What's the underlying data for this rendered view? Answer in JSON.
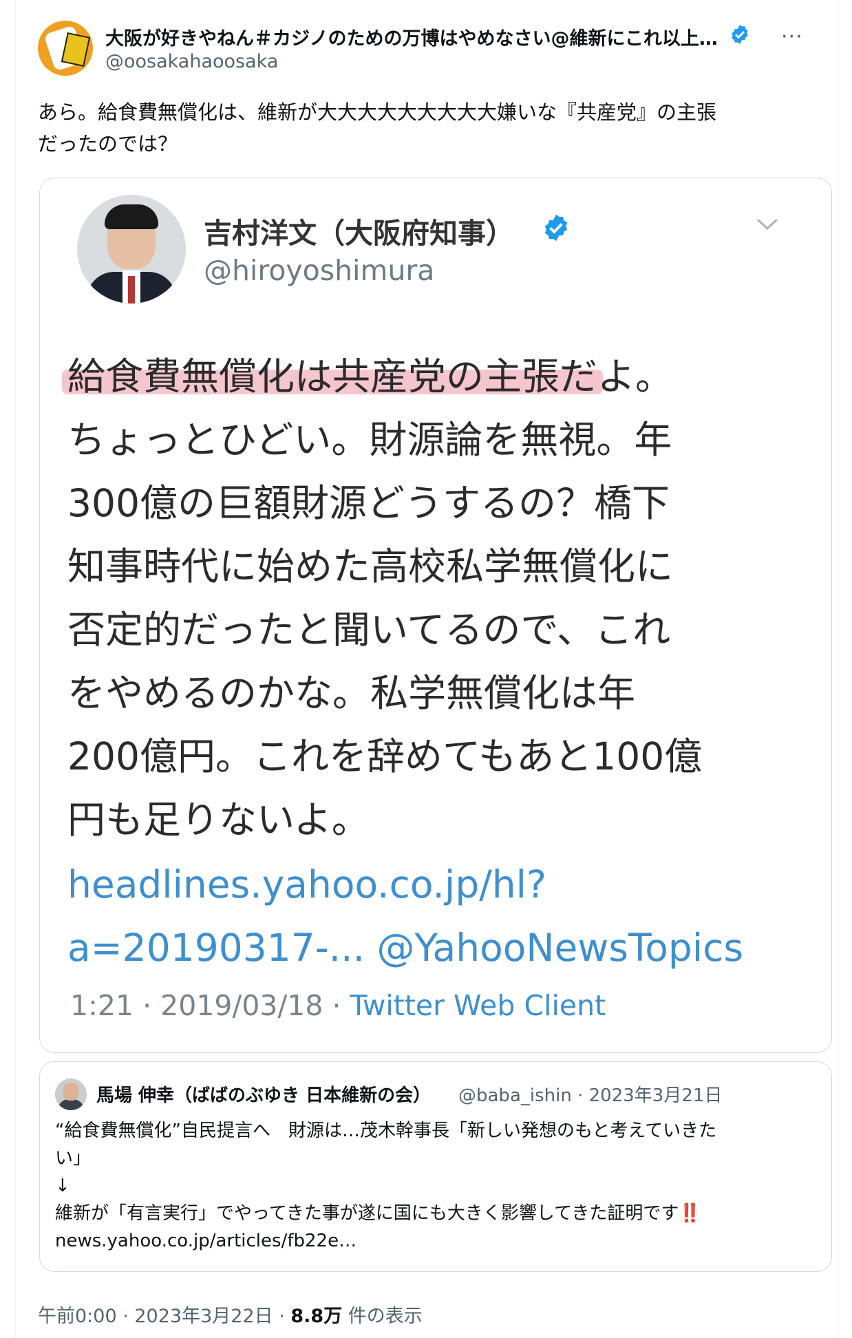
{
  "author": {
    "display_name": "大阪が好きやねん＃カジノのための万博はやめなさい@維新にこれ以上…",
    "handle": "@oosakahaoosaka"
  },
  "more_glyph": "···",
  "tweet": {
    "text_line1": "あら。給食費無償化は、維新が大大大大大大大大大嫌いな『共産党』の主張",
    "text_line2": "だったのでは？"
  },
  "embedded": {
    "name": "吉村洋文（大阪府知事）",
    "handle": "@hiroyoshimura",
    "highlight_line": "給食費無償化は共産党の主張だよ。",
    "body_lines": [
      "ちょっとひどい。財源論を無視。年",
      "300億の巨額財源どうするの？橋下",
      "知事時代に始めた高校私学無償化に",
      "否定的だったと聞いてるので、これ",
      "をやめるのかな。私学無償化は年",
      "200億円。これを辞めてもあと100億",
      "円も足りないよ。"
    ],
    "link_line1": "headlines.yahoo.co.jp/hl?",
    "link_line2": "a=20190317-... @YahooNewsTopics",
    "time": "1:21 · 2019/03/18 · ",
    "client": "Twitter Web Client"
  },
  "quote": {
    "name": "馬場 伸幸（ばばのぶゆき 日本維新の会）",
    "handle_date": "@baba_ishin · 2023年3月21日",
    "text": "“給食費無償化”自民提言へ　財源は…茂木幹事長「新しい発想のもと考えていきた\nい」\n↓\n維新が「有言実行」でやってきた事が遂に国にも大きく影響してきた証明です‼️\nnews.yahoo.co.jp/articles/fb22e…"
  },
  "footer": {
    "time": "午前0:00 · 2023年3月22日 · ",
    "views": "8.8万",
    "views_label": " 件の表示"
  },
  "colors": {
    "verified": "#1d9bf0",
    "link": "#3d8fd0",
    "highlight": "#f6c6cf"
  }
}
